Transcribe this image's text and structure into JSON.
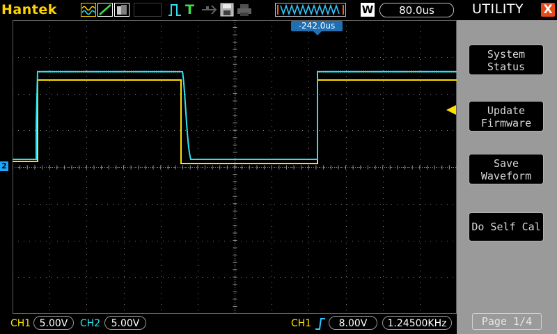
{
  "brand": "Hantek",
  "timebase": {
    "mode_letter": "W",
    "value": "80.0us"
  },
  "trigger_time": "-242.0us",
  "menu": {
    "title": "UTILITY",
    "close_label": "X",
    "items": [
      {
        "label_line1": "System",
        "label_line2": "Status"
      },
      {
        "label_line1": "Update",
        "label_line2": "Firmware"
      },
      {
        "label_line1": "Save",
        "label_line2": "Waveform"
      },
      {
        "label_line1": "Do Self Cal",
        "label_line2": ""
      }
    ],
    "page": "Page 1/4"
  },
  "status": {
    "ch1_label": "CH1",
    "ch1_scale": "5.00V",
    "ch2_label": "CH2",
    "ch2_scale": "5.00V",
    "trig_source": "CH1",
    "trig_level": "8.00V",
    "frequency": "1.24500KHz"
  },
  "ch2_marker": "2",
  "colors": {
    "ch1": "#ffe000",
    "ch2": "#30e0f0",
    "grid": "#808080",
    "panel": "#9a9a9a",
    "brand": "#ffd400"
  },
  "icons": [
    "wave-mode-icon",
    "line-mode-icon",
    "persist-icon",
    "pulse-trigger-icon",
    "run-icon",
    "usb-icon",
    "save-icon",
    "print-icon",
    "memory-depth-icon"
  ]
}
